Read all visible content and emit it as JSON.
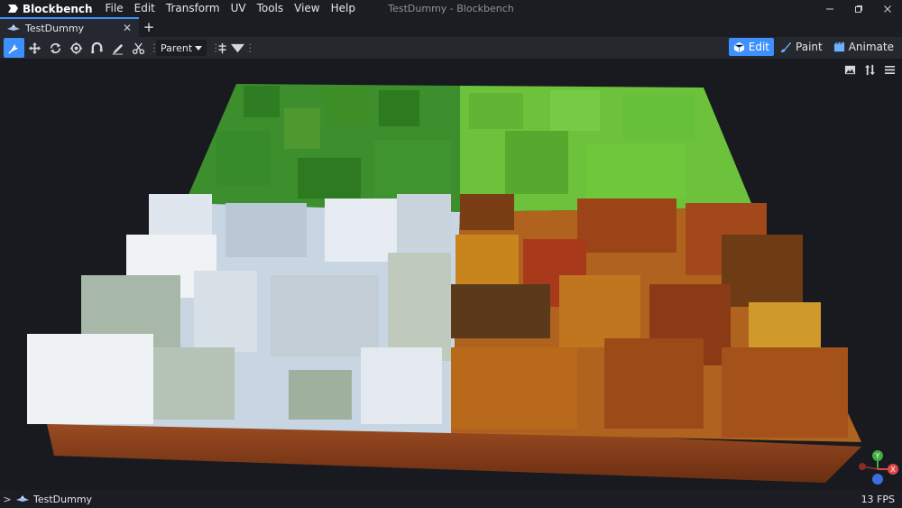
{
  "app": {
    "name": "Blockbench",
    "window_title": "TestDummy - Blockbench"
  },
  "menu": [
    "File",
    "Edit",
    "Transform",
    "UV",
    "Tools",
    "View",
    "Help"
  ],
  "tabs": [
    {
      "label": "TestDummy"
    }
  ],
  "toolbar": {
    "tools": [
      "move-tool-icon",
      "translate-icon",
      "rotate-icon",
      "pivot-icon",
      "vertex-snap-icon",
      "brush-icon",
      "scissors-icon"
    ],
    "pivot_select": "Parent"
  },
  "modes": [
    {
      "label": "Edit",
      "icon": "cube-icon",
      "active": true
    },
    {
      "label": "Paint",
      "icon": "paintbrush-icon",
      "active": false
    },
    {
      "label": "Animate",
      "icon": "film-icon",
      "active": false
    }
  ],
  "viewport": {
    "gizmo_axes": [
      "Y",
      "X",
      "Z"
    ],
    "colors": {
      "x": "#e04848",
      "y": "#3fae3f",
      "z": "#3b6fe0"
    }
  },
  "status": {
    "outliner_name": "TestDummy",
    "fps": "13 FPS"
  },
  "colors": {
    "accent": "#3e90ff",
    "bg": "#181a1f",
    "panel": "#25282e"
  }
}
